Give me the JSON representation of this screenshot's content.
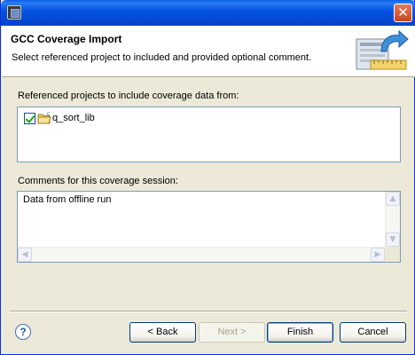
{
  "window": {
    "title": ""
  },
  "header": {
    "title": "GCC Coverage Import",
    "description": "Select referenced project to included and provided optional comment."
  },
  "projects": {
    "label": "Referenced projects to include coverage data from:",
    "items": [
      {
        "label": "q_sort_lib",
        "checked": true
      }
    ]
  },
  "comments": {
    "label": "Comments for this coverage session:",
    "value": "Data from offline run"
  },
  "buttons": {
    "help": "?",
    "back": "< Back",
    "next": "Next >",
    "finish": "Finish",
    "cancel": "Cancel"
  },
  "icons": {
    "app": "window-icon",
    "close": "close-icon",
    "wizard": "import-wizard-icon",
    "project": "project-folder-icon"
  },
  "colors": {
    "titlebar": "#0554e3",
    "border": "#7f9db9",
    "dialog_bg": "#ece9d8"
  }
}
